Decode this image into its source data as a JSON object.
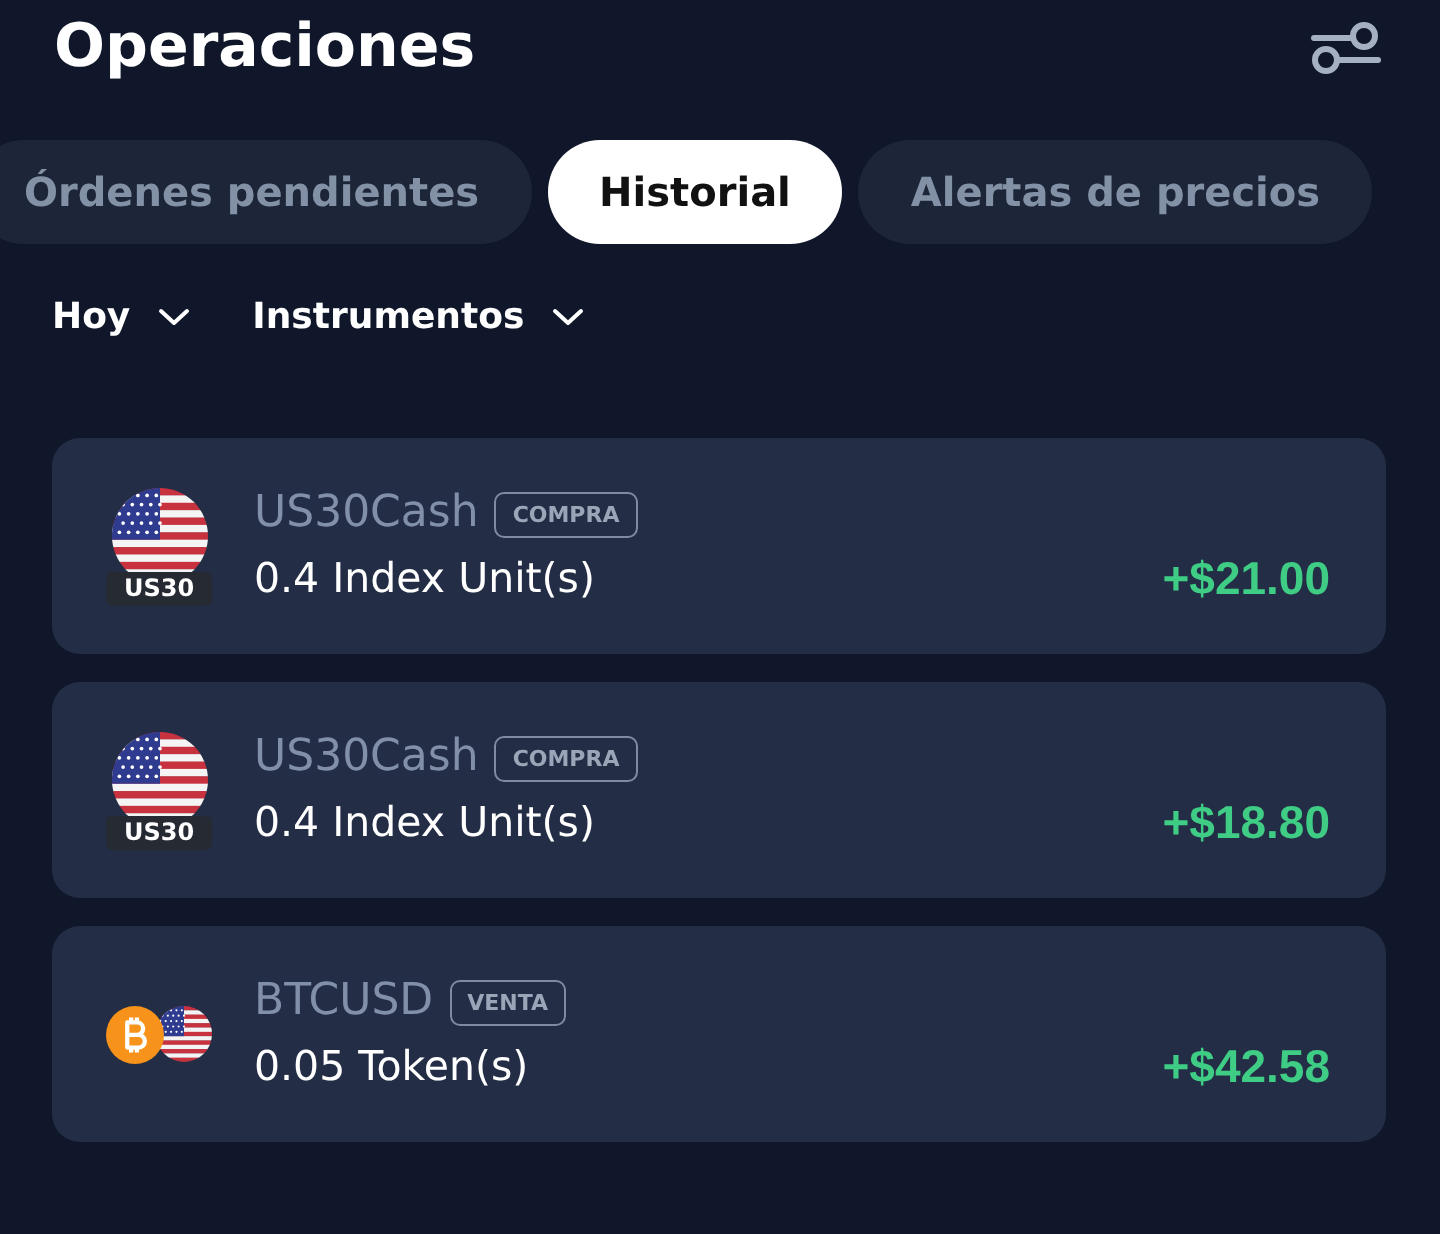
{
  "title": "Operaciones",
  "tabs": [
    {
      "label": "Órdenes pendientes",
      "selected": false
    },
    {
      "label": "Historial",
      "selected": true
    },
    {
      "label": "Alertas de precios",
      "selected": false
    }
  ],
  "filters": [
    "Hoy",
    "Instrumentos"
  ],
  "trades": [
    {
      "kind": "index",
      "symbol": "US30Cash",
      "icon_label": "US30",
      "side": "COMPRA",
      "quantity": "0.4 Index Unit(s)",
      "profit": "+$21.00"
    },
    {
      "kind": "index",
      "symbol": "US30Cash",
      "icon_label": "US30",
      "side": "COMPRA",
      "quantity": "0.4 Index Unit(s)",
      "profit": "+$18.80"
    },
    {
      "kind": "crypto",
      "symbol": "BTCUSD",
      "side": "VENTA",
      "quantity": "0.05 Token(s)",
      "profit": "+$42.58"
    }
  ]
}
